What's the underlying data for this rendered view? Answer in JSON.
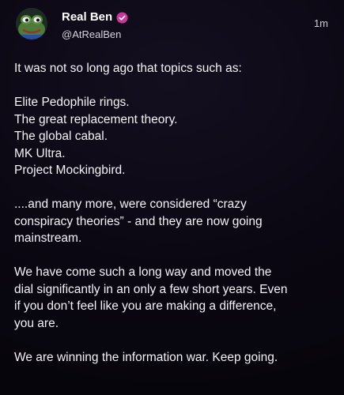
{
  "post": {
    "author": {
      "display_name": "Real Ben",
      "handle": "@AtRealBen",
      "verified_icon": "verified-badge-icon",
      "avatar_icon": "frog-avatar-icon"
    },
    "timestamp": "1m",
    "paragraphs": [
      [
        "It was not so long ago that topics such as:"
      ],
      [
        "Elite Pedophile rings.",
        "The great replacement theory.",
        "The global cabal.",
        "MK Ultra.",
        "Project Mockingbird."
      ],
      [
        "....and many more, were considered “crazy",
        "conspiracy theories” - and they are now going",
        "mainstream."
      ],
      [
        "We have come such a long way and moved the",
        "dial significantly in an only a few short years. Even",
        "if you don’t feel like you are making a difference,",
        "you are."
      ],
      [
        "We are winning the information war. Keep going."
      ]
    ],
    "colors": {
      "background": "#0a0712",
      "text": "#ffffff",
      "muted": "#cfcad6",
      "verified_badge": "#c8389a"
    }
  }
}
